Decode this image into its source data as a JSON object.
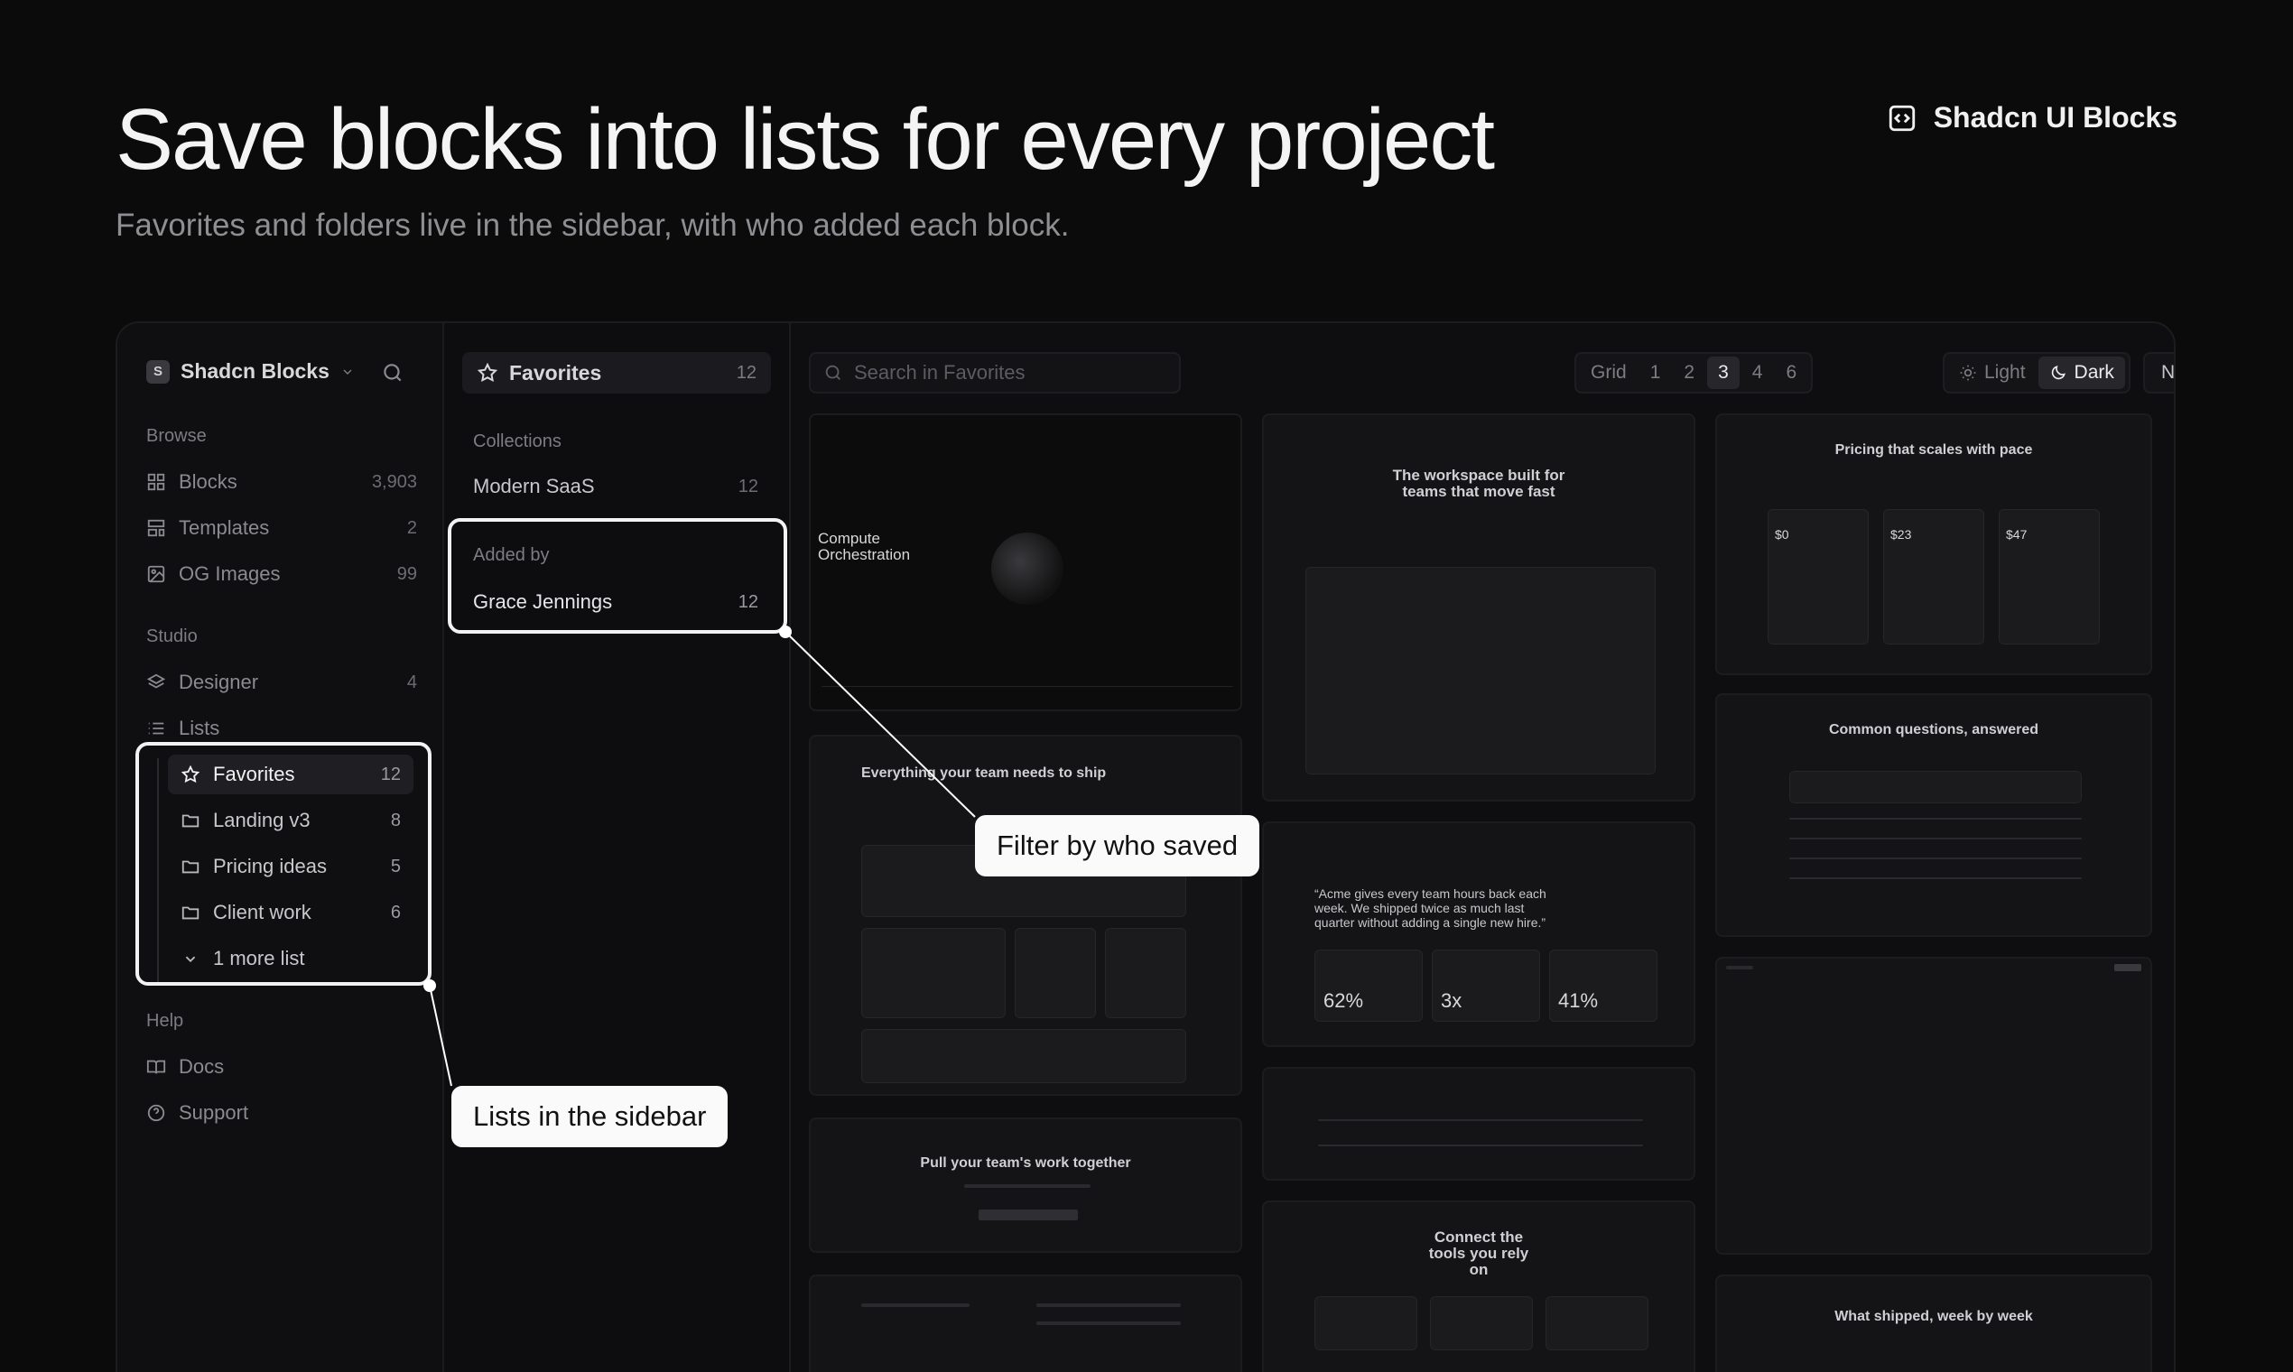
{
  "hero": {
    "title": "Save blocks into lists for every project",
    "subtitle": "Favorites and folders live in the sidebar, with who added each block.",
    "brand": "Shadcn UI Blocks"
  },
  "sidebar": {
    "workspace": "Shadcn Blocks",
    "workspace_initial": "S",
    "browse_label": "Browse",
    "browse": [
      {
        "label": "Blocks",
        "count": "3,903"
      },
      {
        "label": "Templates",
        "count": "2"
      },
      {
        "label": "OG Images",
        "count": "99"
      }
    ],
    "studio_label": "Studio",
    "designer": {
      "label": "Designer",
      "count": "4"
    },
    "lists_label": "Lists",
    "lists": [
      {
        "label": "Favorites",
        "count": "12"
      },
      {
        "label": "Landing v3",
        "count": "8"
      },
      {
        "label": "Pricing ideas",
        "count": "5"
      },
      {
        "label": "Client work",
        "count": "6"
      }
    ],
    "more": "1 more list",
    "help_label": "Help",
    "help": [
      {
        "label": "Docs"
      },
      {
        "label": "Support"
      }
    ]
  },
  "panel": {
    "title": "Favorites",
    "count": "12",
    "collections_label": "Collections",
    "collection": {
      "label": "Modern SaaS",
      "count": "12"
    },
    "added_by_label": "Added by",
    "added_by": {
      "label": "Grace Jennings",
      "count": "12"
    }
  },
  "toolbar": {
    "search_placeholder": "Search in Favorites",
    "grid_label": "Grid",
    "grid_options": [
      "1",
      "2",
      "3",
      "4",
      "6"
    ],
    "grid_selected": "3",
    "theme_light": "Light",
    "theme_dark": "Dark",
    "sort": "Newest"
  },
  "cards": {
    "c1_title": "Compute Orchestration",
    "c2_title": "The workspace built for teams that move fast",
    "c3_title": "Pricing that scales with pace",
    "c3_prices": [
      "$0",
      "$23",
      "$47"
    ],
    "c4_title": "Everything your team needs to ship",
    "c5_quote": "“Acme gives every team hours back each week. We shipped twice as much last quarter without adding a single new hire.”",
    "c5_stats": [
      "62%",
      "3x",
      "41%"
    ],
    "c6_title": "Common questions, answered",
    "c7_title": "Pull your team's work together",
    "c8_title": "Connect the tools you rely on",
    "c9_title": "What shipped, week by week"
  },
  "callouts": {
    "filter": "Filter by who saved",
    "lists": "Lists in the sidebar"
  },
  "colors": {
    "background": "#0b0b0c",
    "accent": "#fafafa"
  }
}
